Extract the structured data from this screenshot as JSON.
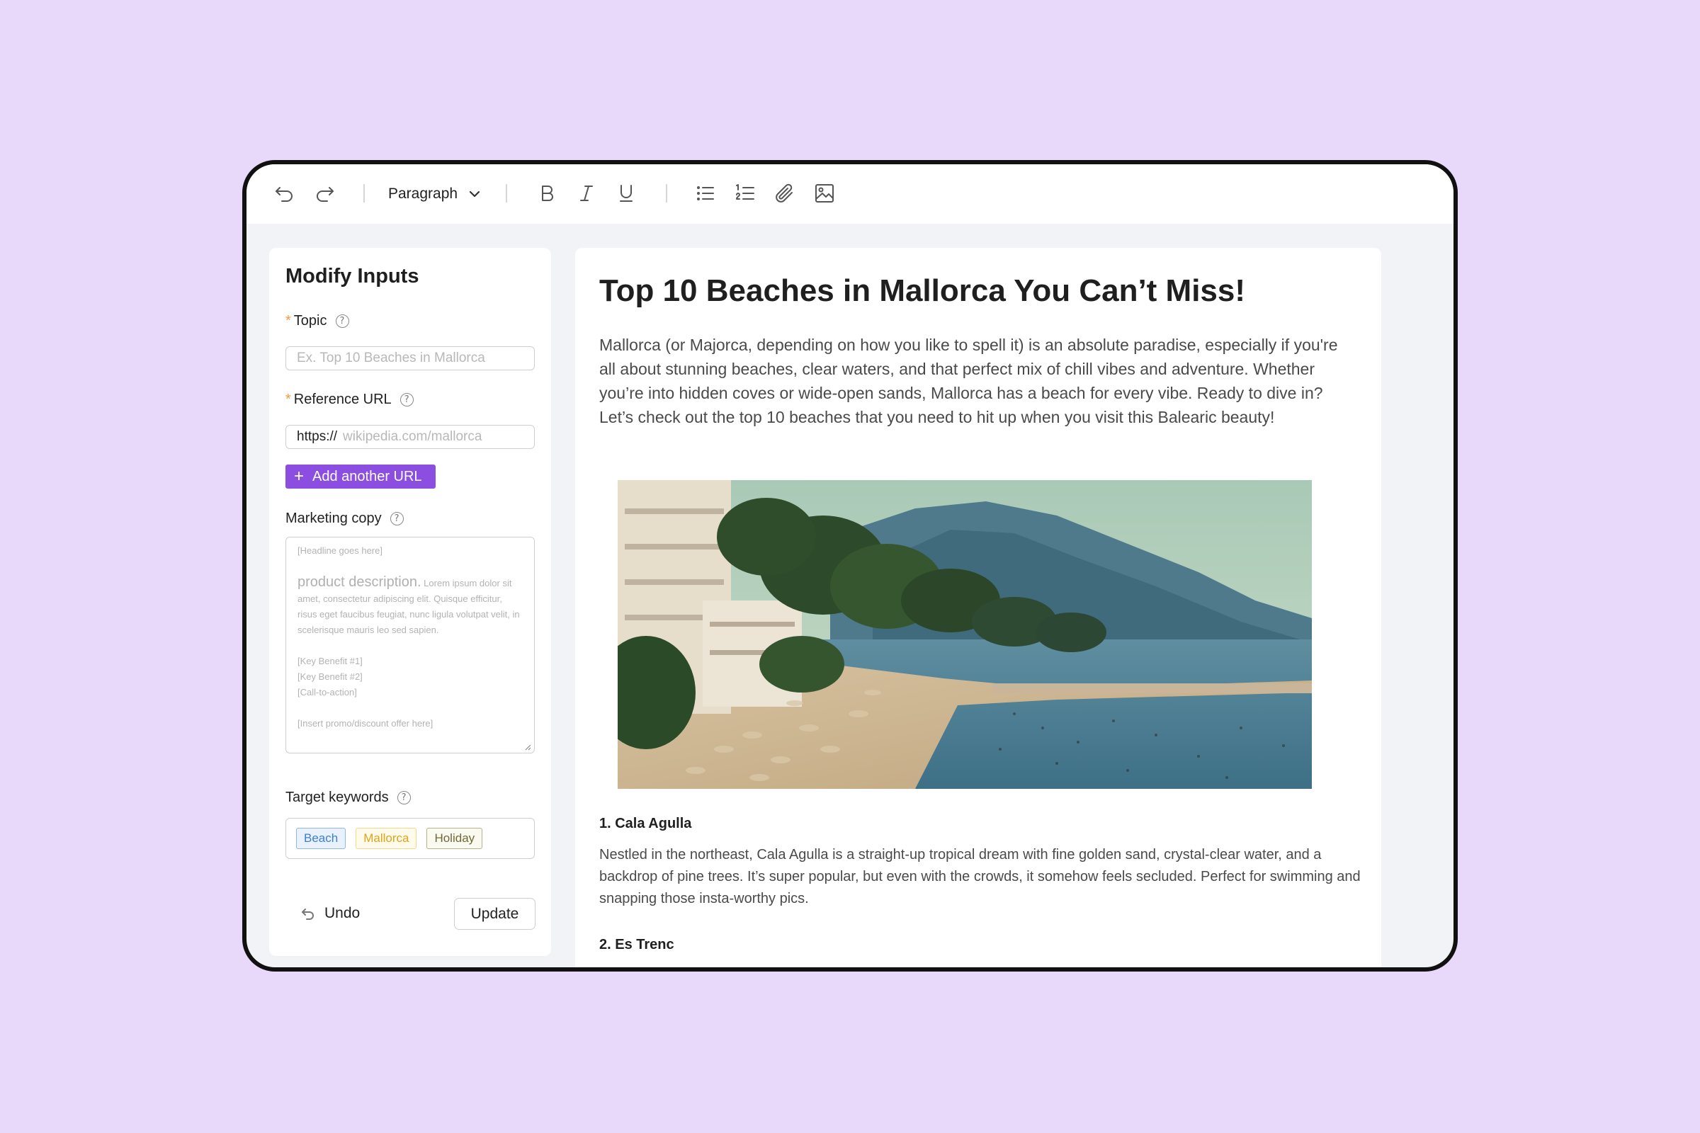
{
  "toolbar": {
    "block_format": "Paragraph",
    "icons": [
      "undo-icon",
      "redo-icon",
      "chevron-down-icon",
      "bold-icon",
      "italic-icon",
      "underline-icon",
      "bullet-list-icon",
      "numbered-list-icon",
      "attach-icon",
      "image-icon"
    ]
  },
  "panel": {
    "title": "Modify Inputs",
    "topic": {
      "label": "Topic",
      "required_mark": "*",
      "placeholder": "Ex. Top 10 Beaches in Mallorca"
    },
    "reference_url": {
      "label": "Reference URL",
      "required_mark": "*",
      "prefix": "https://",
      "placeholder": "wikipedia.com/mallorca"
    },
    "add_url_label": "Add another URL",
    "marketing_copy": {
      "label": "Marketing copy",
      "headline": "[Headline goes here]",
      "desc_big": "product description.",
      "desc_small": "Lorem ipsum dolor sit amet, consectetur adipiscing elit. Quisque efficitur, risus eget faucibus feugiat, nunc ligula volutpat velit, in scelerisque mauris leo sed sapien.",
      "benefit1": "[Key Benefit #1]",
      "benefit2": "[Key Benefit #2]",
      "cta": "[Call-to-action]",
      "promo": "[Insert promo/discount offer here]"
    },
    "keywords": {
      "label": "Target keywords",
      "tags": [
        {
          "text": "Beach",
          "color": "#3d7fd6",
          "bg": "#e8f1fc",
          "border": "#8fb8ec"
        },
        {
          "text": "Mallorca",
          "color": "#e0a21a",
          "bg": "#fffbea",
          "border": "#f3d98a"
        },
        {
          "text": "Holiday",
          "color": "#6f6a35",
          "bg": "#fafaf0",
          "border": "#b6b38a"
        }
      ]
    },
    "undo_label": "Undo",
    "update_label": "Update"
  },
  "article": {
    "title": "Top 10 Beaches in Mallorca You Can’t Miss!",
    "intro": "Mallorca (or Majorca, depending on how you like to spell it) is an absolute paradise, especially if you're all about stunning beaches, clear waters, and that perfect mix of chill vibes and adventure. Whether you’re into hidden coves or wide-open sands, Mallorca has a beach for every vibe. Ready to dive in? Let’s check out the top 10 beaches that you need to hit up when you visit this Balearic beauty!",
    "sections": [
      {
        "heading": "1. Cala Agulla",
        "body": "Nestled in the northeast, Cala Agulla is a straight-up tropical dream with fine golden sand, crystal-clear water, and a backdrop of pine trees. It’s super popular, but even with the crowds, it somehow feels secluded. Perfect for swimming and snapping those insta-worthy pics."
      },
      {
        "heading": "2. Es Trenc"
      }
    ]
  }
}
